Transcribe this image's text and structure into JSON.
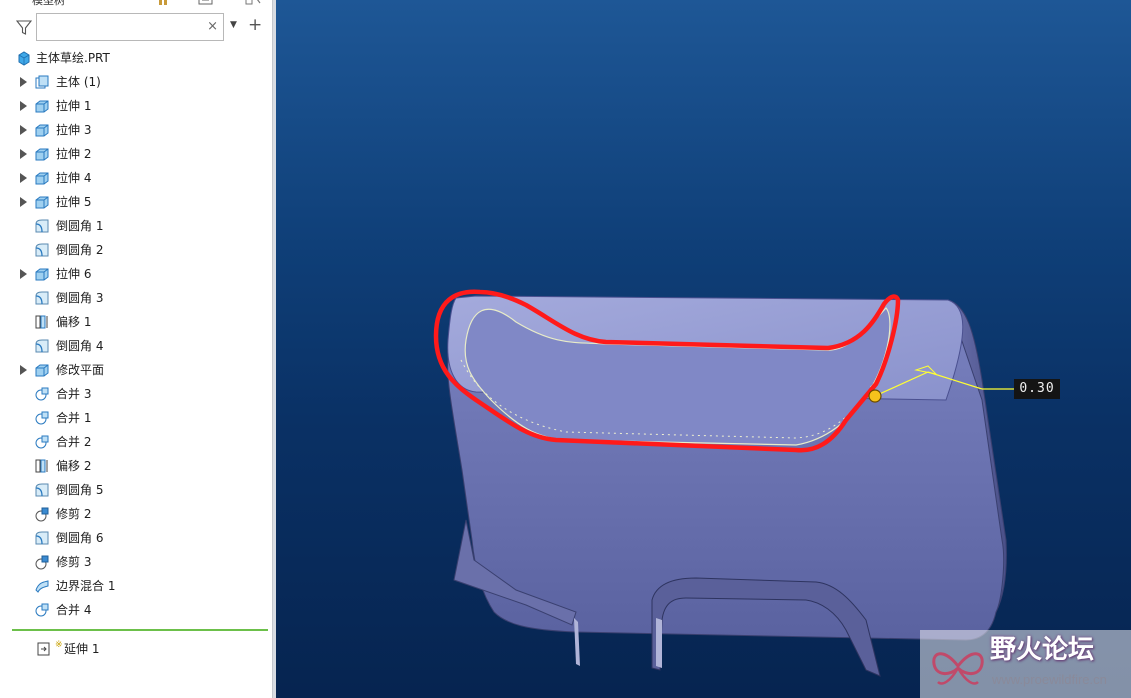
{
  "panel": {
    "title": "模型树",
    "search": {
      "value": "",
      "clear_glyph": "×"
    }
  },
  "tree": {
    "root": {
      "label": "主体草绘.PRT",
      "icon": "part-icon"
    },
    "items": [
      {
        "label": "主体 (1)",
        "icon": "body-icon",
        "expandable": true
      },
      {
        "label": "拉伸 1",
        "icon": "extrude-icon",
        "expandable": true
      },
      {
        "label": "拉伸 3",
        "icon": "extrude-icon",
        "expandable": true
      },
      {
        "label": "拉伸 2",
        "icon": "extrude-icon",
        "expandable": true
      },
      {
        "label": "拉伸 4",
        "icon": "extrude-icon",
        "expandable": true
      },
      {
        "label": "拉伸 5",
        "icon": "extrude-icon",
        "expandable": true
      },
      {
        "label": "倒圆角 1",
        "icon": "round-icon",
        "expandable": false
      },
      {
        "label": "倒圆角 2",
        "icon": "round-icon",
        "expandable": false
      },
      {
        "label": "拉伸 6",
        "icon": "extrude-icon",
        "expandable": true
      },
      {
        "label": "倒圆角 3",
        "icon": "round-icon",
        "expandable": false
      },
      {
        "label": "偏移 1",
        "icon": "offset-icon",
        "expandable": false
      },
      {
        "label": "倒圆角 4",
        "icon": "round-icon",
        "expandable": false
      },
      {
        "label": "修改平面",
        "icon": "extrude-icon",
        "expandable": true
      },
      {
        "label": "合并 3",
        "icon": "merge-icon",
        "expandable": false
      },
      {
        "label": "合并 1",
        "icon": "merge-icon",
        "expandable": false
      },
      {
        "label": "合并 2",
        "icon": "merge-icon",
        "expandable": false
      },
      {
        "label": "偏移 2",
        "icon": "offset-icon",
        "expandable": false
      },
      {
        "label": "倒圆角 5",
        "icon": "round-icon",
        "expandable": false
      },
      {
        "label": "修剪 2",
        "icon": "trim-icon",
        "expandable": false
      },
      {
        "label": "倒圆角 6",
        "icon": "round-icon",
        "expandable": false
      },
      {
        "label": "修剪 3",
        "icon": "trim-icon",
        "expandable": false
      },
      {
        "label": "边界混合 1",
        "icon": "boundary-blend-icon",
        "expandable": false
      },
      {
        "label": "合并 4",
        "icon": "merge-icon",
        "expandable": false
      }
    ],
    "insert_here_color": "#6cc04a",
    "post_insert": {
      "label": "延伸 1",
      "icon": "extend-icon",
      "marker_glyph": "※"
    }
  },
  "viewport": {
    "background_top": "#1e5796",
    "background_bottom": "#062450",
    "highlight_color": "#ff1a1a",
    "dimension": {
      "value": "0.30"
    }
  },
  "watermark": {
    "title": "野火论坛",
    "url": "www.proewildfire.cn"
  }
}
